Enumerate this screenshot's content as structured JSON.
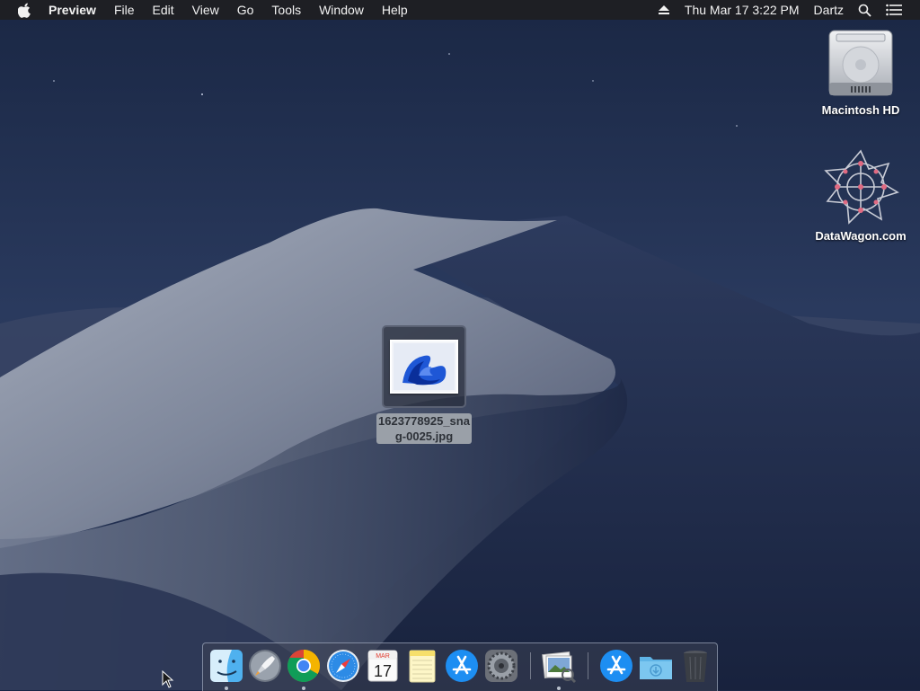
{
  "menubar": {
    "app_name": "Preview",
    "menus": [
      "File",
      "Edit",
      "View",
      "Go",
      "Tools",
      "Window",
      "Help"
    ],
    "datetime": "Thu Mar 17  3:22 PM",
    "user": "Dartz"
  },
  "desktop": {
    "icons": [
      {
        "label": "Macintosh HD",
        "icon": "hard-drive-icon"
      },
      {
        "label": "DataWagon.com",
        "icon": "network-server-icon"
      }
    ],
    "selected_file": {
      "label_line1": "1623778925_sna",
      "label_line2": "g-0025.jpg",
      "icon": "jpg-thumbnail-icon"
    }
  },
  "dock": {
    "items": [
      {
        "name": "Finder",
        "icon": "finder-icon",
        "running": true
      },
      {
        "name": "Launchpad",
        "icon": "launchpad-icon",
        "running": false
      },
      {
        "name": "Google Chrome",
        "icon": "chrome-icon",
        "running": true
      },
      {
        "name": "Safari",
        "icon": "safari-icon",
        "running": false
      },
      {
        "name": "Calendar",
        "icon": "calendar-icon",
        "running": false,
        "month": "MAR",
        "day": "17"
      },
      {
        "name": "Notes",
        "icon": "notes-icon",
        "running": false
      },
      {
        "name": "App Store",
        "icon": "app-store-icon",
        "running": false
      },
      {
        "name": "System Preferences",
        "icon": "system-preferences-icon",
        "running": false
      },
      {
        "name": "Preview",
        "icon": "preview-icon",
        "running": true
      },
      {
        "name": "Applications",
        "icon": "applications-stack-icon",
        "running": false
      },
      {
        "name": "Downloads",
        "icon": "downloads-folder-icon",
        "running": false
      },
      {
        "name": "Trash",
        "icon": "trash-icon",
        "running": false
      }
    ]
  },
  "colors": {
    "menubar_bg": "#1e1f24",
    "wallpaper_sky": "#1f2d50",
    "wallpaper_dune": "#8e96a8",
    "file_label_bg": "#9aa0a8"
  }
}
